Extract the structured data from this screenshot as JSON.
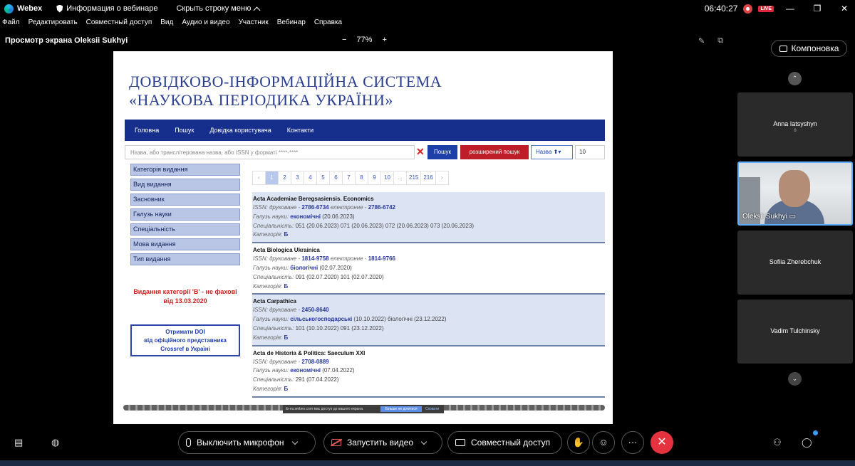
{
  "titlebar": {
    "app_name": "Webex",
    "webinar_info": "Информация о вебинаре",
    "hide_menu": "Скрыть строку меню",
    "clock": "06:40:27",
    "live": "LIVE"
  },
  "menu": [
    "Файл",
    "Редактировать",
    "Совместный доступ",
    "Вид",
    "Аудио и видео",
    "Участник",
    "Вебинар",
    "Справка"
  ],
  "share": {
    "title": "Просмотр экрана Oleksii Sukhyi",
    "zoom_minus": "−",
    "zoom": "77%",
    "zoom_plus": "+"
  },
  "site": {
    "title_line1": "ДОВІДКОВО-ІНФОРМАЦІЙНА СИСТЕМА",
    "title_line2": "«НАУКОВА ПЕРІОДИКА УКРАЇНИ»",
    "nav": [
      "Головна",
      "Пошук",
      "Довідка користувача",
      "Контакти"
    ],
    "search_placeholder": "Назва, або транслітерована назва, або ISSN у форматі ****-****",
    "search_button": "Пошук",
    "extended_search_button": "розширений пошук",
    "sort_label": "Назва",
    "per_page": "10",
    "sidebar": [
      "Категорія видання",
      "Вид видання",
      "Засновник",
      "Галузь науки",
      "Спеціальність",
      "Мова видання",
      "Тип видання"
    ],
    "note_line1": "Видання категорії 'В' - не фахові",
    "note_line2": "від 13.03.2020",
    "doi_line1": "Отримати DOI",
    "doi_line2": "від офіційного представника",
    "doi_line3": "Crossref в Україні",
    "pagination": [
      "‹",
      "1",
      "2",
      "3",
      "4",
      "5",
      "6",
      "7",
      "8",
      "9",
      "10",
      "...",
      "215",
      "216",
      "›"
    ],
    "results": [
      {
        "title": "Acta Academiae Beregsasiensis. Economics",
        "issn_label": "ISSN: друковане - ",
        "issn_print": "2786-6734",
        "issn_e_label": " електронне - ",
        "issn_e": "2786-6742",
        "field_label": "Галузь науки: ",
        "field": "економічні",
        "field_date": " (20.06.2023)",
        "spec_label": "Спеціальність: ",
        "specs": "051 (20.06.2023) 071 (20.06.2023) 072 (20.06.2023) 073 (20.06.2023)",
        "cat_label": "Категорія: ",
        "cat": "Б"
      },
      {
        "title": "Acta Biologica Ukrainica",
        "issn_label": "ISSN: друковане - ",
        "issn_print": "1814-9758",
        "issn_e_label": " електронне - ",
        "issn_e": "1814-9766",
        "field_label": "Галузь науки: ",
        "field": "біологічні",
        "field_date": " (02.07.2020)",
        "spec_label": "Спеціальність: ",
        "specs": "091 (02.07.2020) 101 (02.07.2020)",
        "cat_label": "Категорія: ",
        "cat": "Б"
      },
      {
        "title": "Acta Carpathica",
        "issn_label": "ISSN: друковане - ",
        "issn_print": "2450-8640",
        "issn_e_label": "",
        "issn_e": "",
        "field_label": "Галузь науки: ",
        "field": "сільськогосподарські",
        "field_date": " (10.10.2022) біологічні (23.12.2022)",
        "spec_label": "Спеціальність: ",
        "specs": "101 (10.10.2022) 091 (23.12.2022)",
        "cat_label": "Категорія: ",
        "cat": "Б"
      },
      {
        "title": "Acta de Historia & Politica: Saeculum XXI",
        "issn_label": "ISSN: друковане - ",
        "issn_print": "2708-0889",
        "issn_e_label": "",
        "issn_e": "",
        "field_label": "Галузь науки: ",
        "field": "економічні",
        "field_date": " (07.04.2022)",
        "spec_label": "Спеціальність: ",
        "specs": "291 (07.04.2022)",
        "cat_label": "Категорія: ",
        "cat": "Б"
      }
    ],
    "notification": "tb-eu.webex.com має доступ до вашого екрана.",
    "notification_button": "Більше не ділитися",
    "notification_hide": "Сховати"
  },
  "panel": {
    "layout": "Компоновка",
    "participants": [
      {
        "name": "Anna Iatsyshyn",
        "sub": "8"
      },
      {
        "name": "Oleksii Sukhyi"
      },
      {
        "name": "Sofiia Zherebchuk"
      },
      {
        "name": "Vadim Tulchinsky"
      }
    ]
  },
  "toolbar": {
    "mute": "Выключить микрофон",
    "video": "Запустить видео",
    "share": "Совместный доступ",
    "more": "···"
  },
  "colors": {
    "nav_blue": "#162f8c",
    "title_blue": "#2a3f92",
    "ext_red": "#bd1e27",
    "end_call": "#e5323f"
  }
}
